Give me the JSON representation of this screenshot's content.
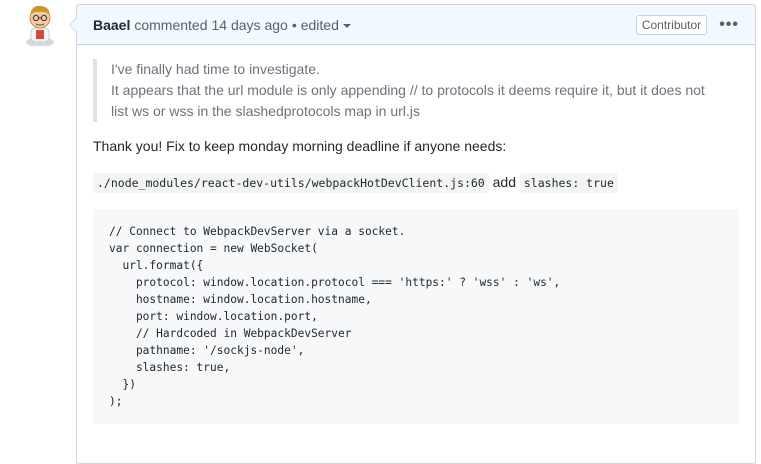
{
  "comment": {
    "author": "Baael",
    "action": "commented",
    "time": "14 days ago",
    "separator": "•",
    "edited": "edited",
    "badge": "Contributor",
    "more_menu": "•••"
  },
  "body": {
    "quote_lines": [
      "I've finally had time to investigate.",
      "It appears that the url module is only appending // to protocols it deems require it, but it does not list ws or wss in the slashedprotocols map in url.js"
    ],
    "paragraph": "Thank you! Fix to keep monday morning deadline if anyone needs:",
    "code_path": "./node_modules/react-dev-utils/webpackHotDevClient.js:60",
    "connector": "add",
    "code_snippet": "slashes: true",
    "code_block": "// Connect to WebpackDevServer via a socket.\nvar connection = new WebSocket(\n  url.format({\n    protocol: window.location.protocol === 'https:' ? 'wss' : 'ws',\n    hostname: window.location.hostname,\n    port: window.location.port,\n    // Hardcoded in WebpackDevServer\n    pathname: '/sockjs-node',\n    slashes: true,\n  })\n);"
  },
  "colors": {
    "header_bg": "#f1f8ff",
    "header_border": "#c0d3eb",
    "code_bg": "#f6f8fa"
  }
}
